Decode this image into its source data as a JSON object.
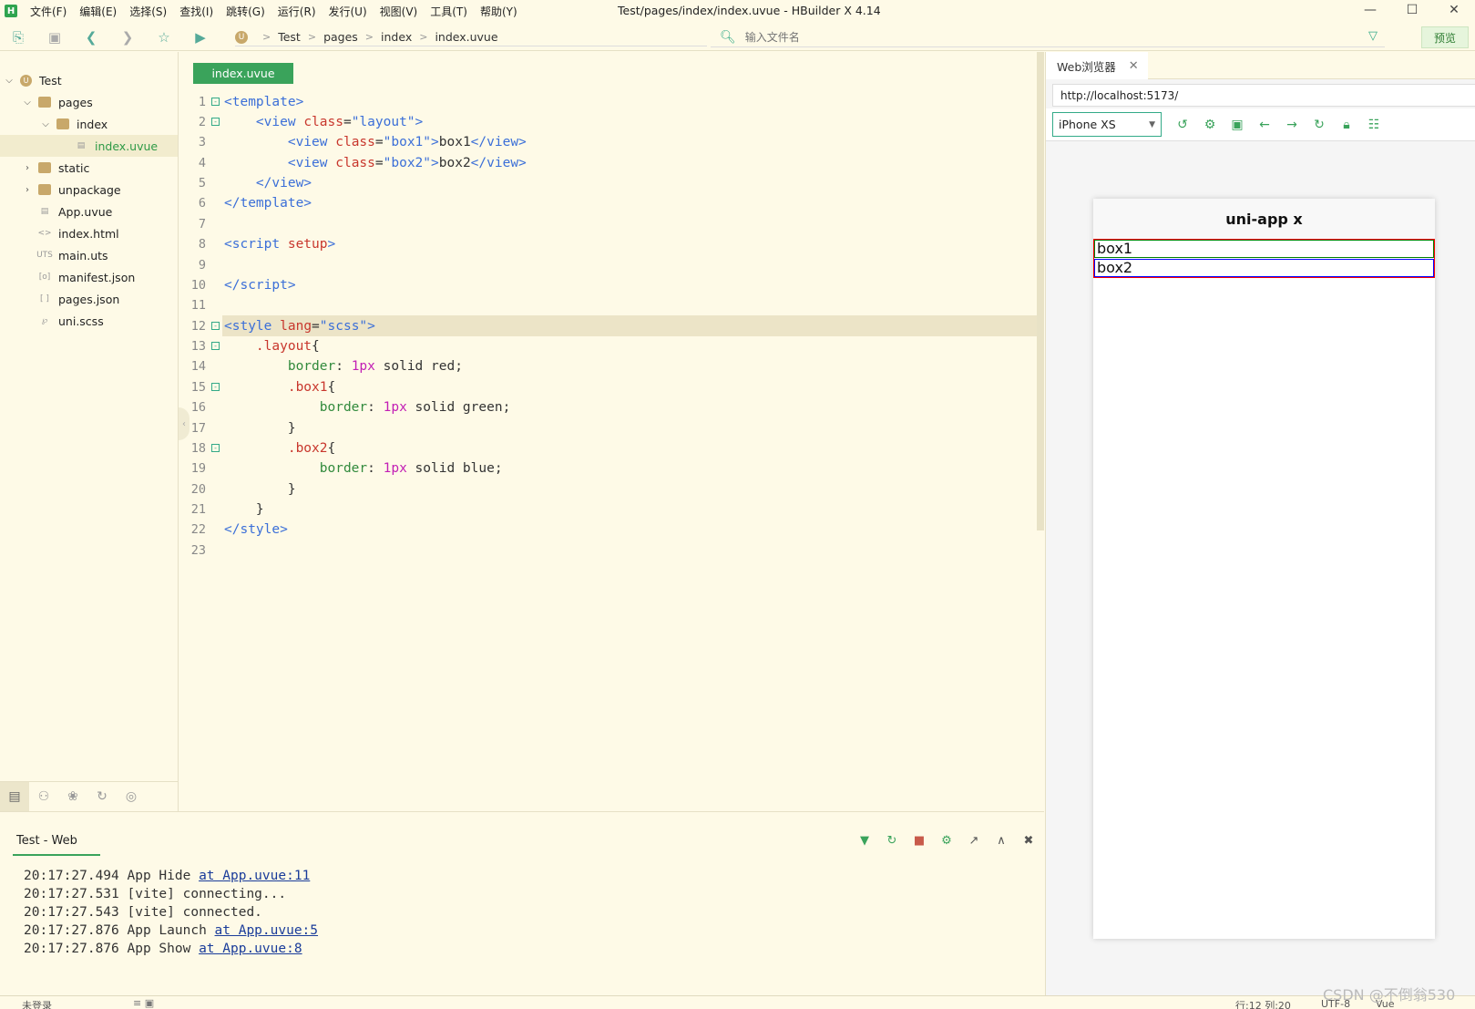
{
  "window": {
    "title": "Test/pages/index/index.uvue - HBuilder X 4.14",
    "logo": "H",
    "menu": [
      "文件(F)",
      "编辑(E)",
      "选择(S)",
      "查找(I)",
      "跳转(G)",
      "运行(R)",
      "发行(U)",
      "视图(V)",
      "工具(T)",
      "帮助(Y)"
    ],
    "controls": [
      "—",
      "☐",
      "✕"
    ]
  },
  "toolbar": {
    "breadcrumb": [
      "Test",
      "pages",
      "index",
      "index.uvue"
    ],
    "file_search_placeholder": "输入文件名",
    "preview_label": "预览"
  },
  "sidebar": {
    "items": [
      {
        "label": "Test",
        "icon": "project-icon"
      },
      {
        "label": "pages",
        "icon": "folder-icon"
      },
      {
        "label": "index",
        "icon": "folder-icon"
      },
      {
        "label": "index.uvue",
        "icon": "uvue-file-icon"
      },
      {
        "label": "static",
        "icon": "folder-icon"
      },
      {
        "label": "unpackage",
        "icon": "folder-icon"
      },
      {
        "label": "App.uvue",
        "icon": "uvue-file-icon"
      },
      {
        "label": "index.html",
        "icon": "html-file-icon"
      },
      {
        "label": "main.uts",
        "icon": "uts-file-icon"
      },
      {
        "label": "manifest.json",
        "icon": "json-file-icon"
      },
      {
        "label": "pages.json",
        "icon": "json-file-icon"
      },
      {
        "label": "uni.scss",
        "icon": "scss-file-icon"
      }
    ]
  },
  "editor": {
    "tab_label": "index.uvue",
    "line_numbers": [
      "1",
      "2",
      "3",
      "4",
      "5",
      "6",
      "7",
      "8",
      "9",
      "10",
      "11",
      "12",
      "13",
      "14",
      "15",
      "16",
      "17",
      "18",
      "19",
      "20",
      "21",
      "22",
      "23"
    ]
  },
  "browser": {
    "tab_label": "Web浏览器",
    "url": "http://localhost:5173/",
    "device": "iPhone XS",
    "page_title": "uni-app x",
    "box1_text": "box1",
    "box2_text": "box2"
  },
  "console": {
    "tab_label": "Test - Web",
    "logs": [
      {
        "time": "20:17:27.494",
        "msg": "App Hide ",
        "link": "at App.uvue:11"
      },
      {
        "time": "20:17:27.531",
        "msg": "[vite] connecting...",
        "link": ""
      },
      {
        "time": "20:17:27.543",
        "msg": "[vite] connected.",
        "link": ""
      },
      {
        "time": "20:17:27.876",
        "msg": "App Launch ",
        "link": "at App.uvue:5"
      },
      {
        "time": "20:17:27.876",
        "msg": "App Show ",
        "link": "at App.uvue:8"
      }
    ]
  },
  "statusbar": {
    "login": "未登录",
    "position": "行:12  列:20",
    "encoding": "UTF-8",
    "language": "Vue"
  },
  "watermark": "CSDN @不倒翁530",
  "colors": {
    "accent": "#3aa35b",
    "background": "#fefae7",
    "box1_border": "green",
    "box2_border": "blue",
    "layout_border": "red"
  }
}
